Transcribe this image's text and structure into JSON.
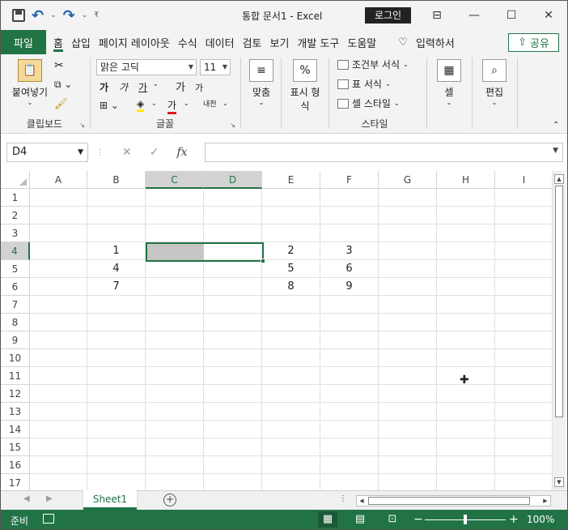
{
  "title": {
    "doc": "통합 문서1  -  Excel",
    "login": "로그인"
  },
  "tabs": {
    "file": "파일",
    "items": [
      "홈",
      "삽입",
      "페이지 레이아웃",
      "수식",
      "데이터",
      "검토",
      "보기",
      "개발 도구",
      "도움말"
    ],
    "tell_me": "입력하서",
    "share": "공유"
  },
  "ribbon": {
    "clipboard": {
      "paste": "붙여넣기",
      "label": "클립보드"
    },
    "font": {
      "name": "맑은 고딕",
      "size": "11",
      "bold": "가",
      "italic": "가",
      "underline": "가",
      "grow": "가",
      "shrink": "가",
      "fontcolor": "가",
      "phonetic": "내천",
      "label": "글꼴"
    },
    "align": {
      "label": "맞춤"
    },
    "number": {
      "label1": "표시 형",
      "label2": "식",
      "icon": "%"
    },
    "styles": {
      "cond": "조건부 서식",
      "table": "표 서식",
      "cell": "셀 스타일",
      "label": "스타일"
    },
    "cells": {
      "label": "셀"
    },
    "editing": {
      "label": "편집"
    }
  },
  "formula": {
    "namebox": "D4",
    "fx": "fx",
    "value": ""
  },
  "columns": [
    "A",
    "B",
    "C",
    "D",
    "E",
    "F",
    "G",
    "H",
    "I"
  ],
  "rows": [
    "1",
    "2",
    "3",
    "4",
    "5",
    "6",
    "7",
    "8",
    "9",
    "10",
    "11",
    "12",
    "13",
    "14",
    "15",
    "16",
    "17"
  ],
  "cells": {
    "B4": "1",
    "E4": "2",
    "F4": "3",
    "B5": "4",
    "E5": "5",
    "F5": "6",
    "B6": "7",
    "E6": "8",
    "F6": "9"
  },
  "sheets": {
    "active": "Sheet1"
  },
  "status": {
    "ready": "준비",
    "zoom": "100%"
  },
  "colors": {
    "accent": "#217346"
  }
}
